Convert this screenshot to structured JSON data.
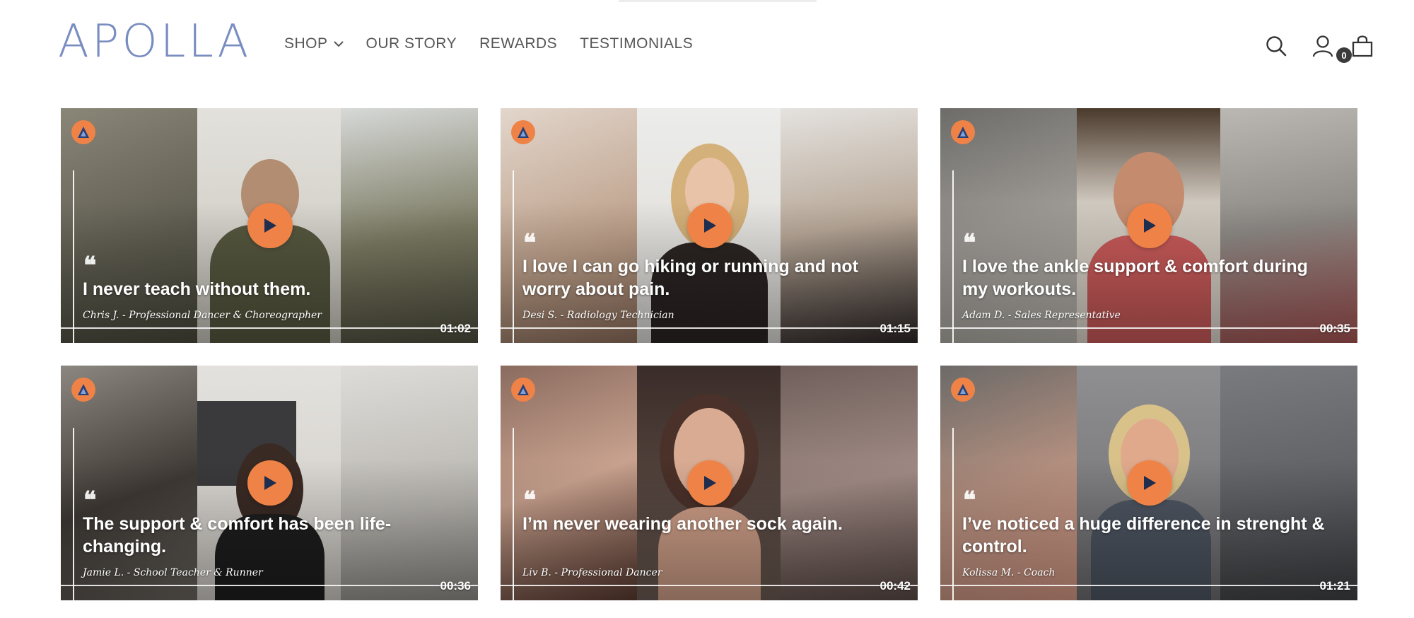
{
  "brand": {
    "logo_text": "APOLLA",
    "logo_color": "#7a8dc1",
    "accent": "#ef8347"
  },
  "nav": {
    "items": [
      {
        "label": "SHOP",
        "has_dropdown": true
      },
      {
        "label": "OUR STORY"
      },
      {
        "label": "REWARDS"
      },
      {
        "label": "TESTIMONIALS"
      }
    ]
  },
  "header_icons": {
    "search": "search-icon",
    "account": "account-icon",
    "cart": "cart-icon",
    "cart_count": "0"
  },
  "testimonials": [
    {
      "quote": "I never teach without them.",
      "author": "Chris J. - Professional Dancer & Choreographer",
      "duration": "01:02"
    },
    {
      "quote": "I love I can go hiking or running and not worry about pain.",
      "author": "Desi S. - Radiology Technician",
      "duration": "01:15"
    },
    {
      "quote": "I love the ankle support & comfort during my workouts.",
      "author": "Adam D. - Sales Representative",
      "duration": "00:35"
    },
    {
      "quote": "The support & comfort has been life-changing.",
      "author": "Jamie L. - School Teacher & Runner",
      "duration": "00:36"
    },
    {
      "quote": "I’m never wearing another sock again.",
      "author": "Liv B. - Professional Dancer",
      "duration": "00:42"
    },
    {
      "quote": "I’ve noticed a huge difference in strenght & control.",
      "author": "Kolissa M. - Coach",
      "duration": "01:21"
    }
  ]
}
